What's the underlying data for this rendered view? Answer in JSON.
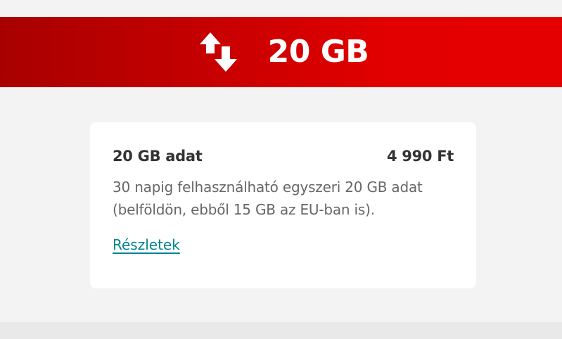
{
  "banner": {
    "icon": "data-transfer-arrows-icon",
    "title": "20 GB",
    "colors": {
      "from": "#a80000",
      "to": "#e40000"
    }
  },
  "offer": {
    "title": "20 GB adat",
    "price": "4 990 Ft",
    "description": "30 napig felhasználható egyszeri 20 GB adat (belföldön, ebből 15 GB az EU-ban is).",
    "details_link": "Részletek",
    "link_color": "#00848f"
  }
}
